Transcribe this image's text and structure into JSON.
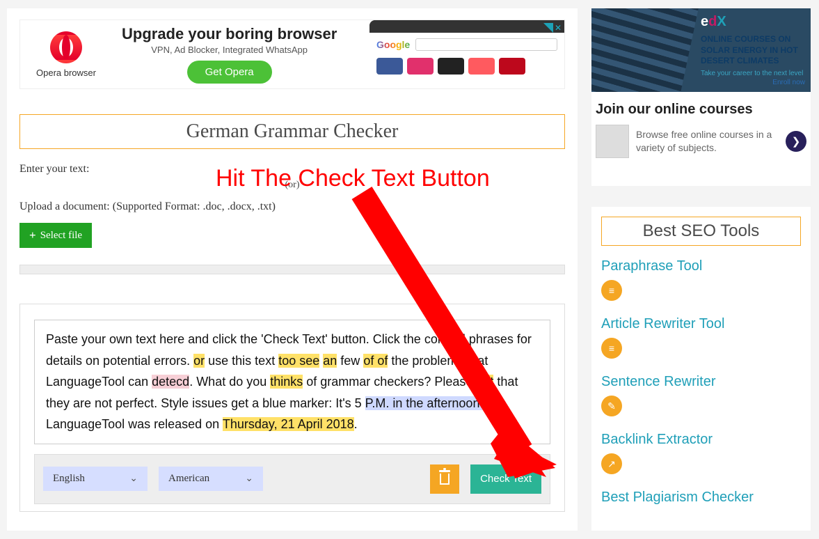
{
  "opera_ad": {
    "brand": "Opera browser",
    "headline": "Upgrade your boring browser",
    "subhead": "VPN, Ad Blocker, Integrated WhatsApp",
    "cta": "Get Opera",
    "search_brand": "Google",
    "applet_colors": [
      "#3b5998",
      "#e1306c",
      "#222222",
      "#ff5a5f",
      "#bd081c"
    ]
  },
  "page_title": "German Grammar Checker",
  "enter_label": "Enter your text:",
  "or_label": "(or)",
  "upload_label": "Upload a document: (Supported Format: .doc, .docx, .txt)",
  "select_file": "Select file",
  "annotation": "Hit The Check Text Button",
  "editor": {
    "segments": [
      {
        "t": "Paste your own text here and click the 'Check Text' button. Click the colored phrases for details on potential errors. "
      },
      {
        "t": "or",
        "cls": "hl-y"
      },
      {
        "t": " use this text "
      },
      {
        "t": "too see",
        "cls": "hl-y"
      },
      {
        "t": " "
      },
      {
        "t": "an",
        "cls": "hl-y"
      },
      {
        "t": " few "
      },
      {
        "t": "of of",
        "cls": "hl-y"
      },
      {
        "t": " the problems that LanguageTool can "
      },
      {
        "t": "detecd",
        "cls": "hl-p"
      },
      {
        "t": ". What do you "
      },
      {
        "t": "thinks",
        "cls": "hl-y"
      },
      {
        "t": " of grammar checkers? Please "
      },
      {
        "t": "not",
        "cls": "hl-y"
      },
      {
        "t": " that they are not perfect. Style issues get a blue marker: It's 5 "
      },
      {
        "t": "P.M. in the afternoon.",
        "cls": "hl-b"
      },
      {
        "t": " LanguageTool was released on "
      },
      {
        "t": "Thursday, 21 April 2018",
        "cls": "hl-y"
      },
      {
        "t": "."
      }
    ]
  },
  "toolbar": {
    "language": "English",
    "variant": "American",
    "check": "Check Text"
  },
  "edx": {
    "logo_e": "e",
    "logo_d": "d",
    "logo_x": "X",
    "title": "ONLINE COURSES ON SOLAR ENERGY IN HOT DESERT CLIMATES",
    "sub": "Take your career to the next level",
    "enroll": "Enroll now",
    "heading": "Join our online courses",
    "desc": "Browse free online courses in a variety of subjects."
  },
  "tools_heading": "Best SEO Tools",
  "tools": [
    {
      "label": "Paraphrase Tool",
      "glyph": "≡"
    },
    {
      "label": "Article Rewriter Tool",
      "glyph": "≡"
    },
    {
      "label": "Sentence Rewriter",
      "glyph": "✎"
    },
    {
      "label": "Backlink Extractor",
      "glyph": "↗"
    },
    {
      "label": "Best Plagiarism Checker",
      "glyph": ""
    }
  ]
}
